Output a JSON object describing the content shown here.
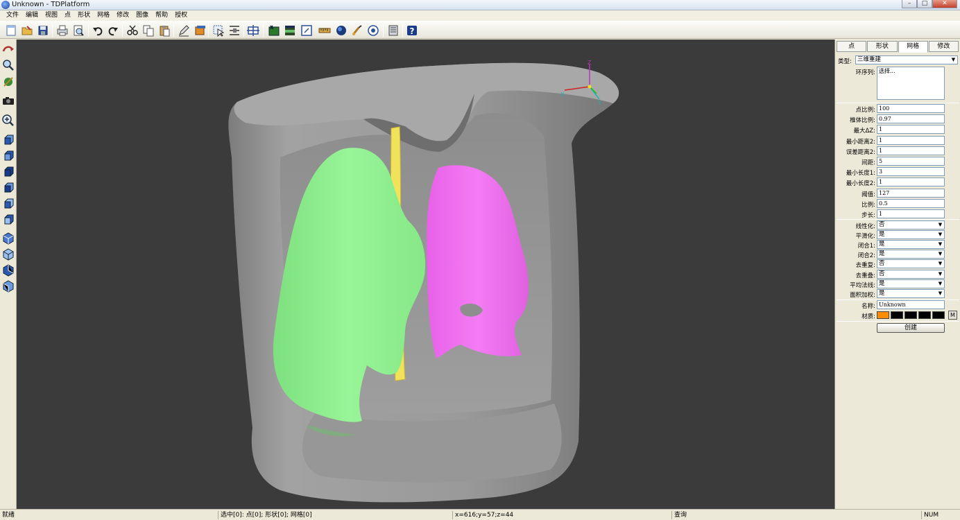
{
  "window": {
    "title": "Unknown - TDPlatform",
    "minimize": "–",
    "maximize": "□",
    "close": "✕"
  },
  "menu": [
    "文件",
    "编辑",
    "视图",
    "点",
    "形状",
    "网格",
    "修改",
    "图像",
    "帮助",
    "授权"
  ],
  "toolbar_icons": [
    "new-file-icon",
    "open-file-icon",
    "save-icon",
    "print-icon",
    "print-preview-icon",
    "undo-icon",
    "redo-icon",
    "cut-icon",
    "copy-icon",
    "paste-icon",
    "pencil-icon",
    "layers-icon",
    "select-icon",
    "measure-icon",
    "fit-view-icon",
    "image-icon",
    "grid-icon",
    "frame-icon",
    "ruler-icon",
    "sphere-icon",
    "brush-icon",
    "settings-icon",
    "data-icon",
    "help-icon"
  ],
  "left_tool_icons": [
    "rotate-icon",
    "zoom-icon",
    "pan-icon",
    "camera-icon",
    "magnify-icon",
    "view-front-icon",
    "view-back-icon",
    "view-left-icon",
    "view-right-icon",
    "view-top-icon",
    "view-bottom-icon",
    "iso-view-1-icon",
    "iso-view-2-icon",
    "iso-view-3-icon",
    "iso-view-4-icon"
  ],
  "panel": {
    "tabs": [
      "点",
      "形状",
      "网格",
      "修改"
    ],
    "active_tab": 2,
    "type_label": "类型:",
    "type_value": "三维重建",
    "sequence_label": "环序列:",
    "sequence_value": "选择...",
    "params": [
      {
        "label": "点比例:",
        "value": "100"
      },
      {
        "label": "椎体比例:",
        "value": "0.97"
      },
      {
        "label": "最大ΔZ:",
        "value": "1"
      },
      {
        "label": "最小距离2:",
        "value": "1"
      },
      {
        "label": "误差距离2:",
        "value": "1"
      },
      {
        "label": "间距:",
        "value": "5"
      },
      {
        "label": "最小长度1:",
        "value": "3"
      },
      {
        "label": "最小长度2:",
        "value": "1"
      },
      {
        "label": "阈值:",
        "value": "127"
      },
      {
        "label": "比例:",
        "value": "0.5"
      },
      {
        "label": "步长:",
        "value": "1"
      }
    ],
    "options": [
      {
        "label": "线性化:",
        "value": "否"
      },
      {
        "label": "平滑化:",
        "value": "是"
      },
      {
        "label": "闭合1:",
        "value": "是"
      },
      {
        "label": "闭合2:",
        "value": "是"
      },
      {
        "label": "去重复:",
        "value": "否"
      },
      {
        "label": "去重叠:",
        "value": "否"
      },
      {
        "label": "平均法线:",
        "value": "是"
      },
      {
        "label": "面积加权:",
        "value": "是"
      }
    ],
    "name_label": "名称:",
    "name_value": "Unknown",
    "material_label": "材质:",
    "material_colors": [
      "#ff8c00",
      "#000000",
      "#000000",
      "#000000",
      "#000000"
    ],
    "material_btn": "M",
    "create_label": "创建"
  },
  "viewport": {
    "axis_z": "Z",
    "axis_x": "X",
    "axis_y": "Y",
    "colors": {
      "body": "#8e8e8e",
      "left_lung": "#8ef08e",
      "right_lung": "#f070f0",
      "trachea": "#f2e25a",
      "background": "#3b3b3b"
    }
  },
  "status": {
    "ready": "就绪",
    "selection": "选中[0]: 点[0]; 形状[0]; 网格[0]",
    "coords": "x=616;y=57;z=44",
    "mode": "查询",
    "num": "NUM"
  }
}
